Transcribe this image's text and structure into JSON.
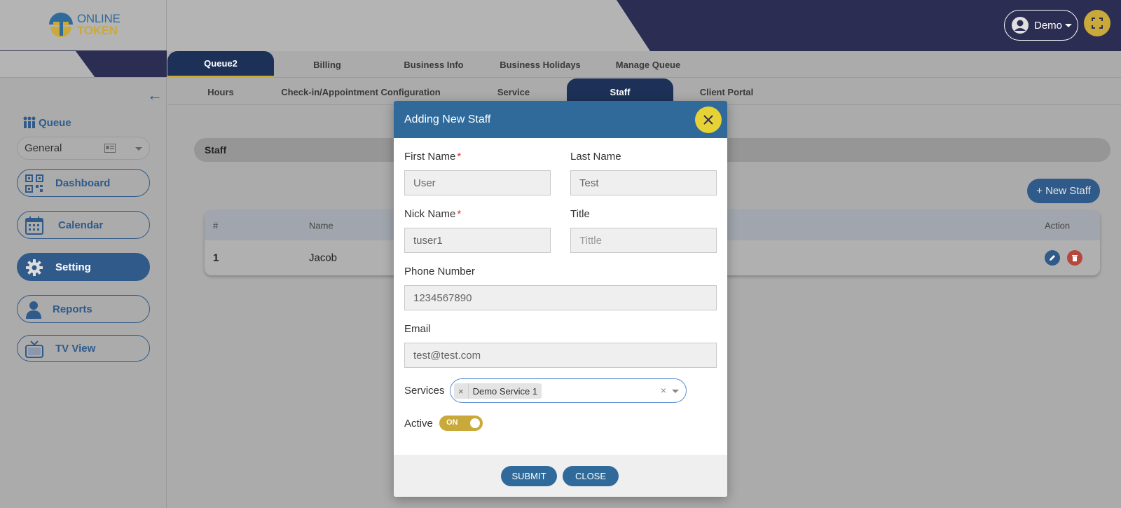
{
  "brand": {
    "line1": "ONLINE",
    "line2": "TOKEN"
  },
  "user_menu": {
    "label": "Demo"
  },
  "sidebar": {
    "queue_label": "Queue",
    "queue_select_value": "General",
    "items": [
      {
        "label": "Dashboard",
        "icon": "qr-code-icon",
        "active": false
      },
      {
        "label": "Calendar",
        "icon": "calendar-icon",
        "active": false
      },
      {
        "label": "Setting",
        "icon": "gear-icon",
        "active": true
      },
      {
        "label": "Reports",
        "icon": "person-icon",
        "active": false
      },
      {
        "label": "TV View",
        "icon": "tv-icon",
        "active": false
      }
    ]
  },
  "tabs_row1": [
    "Queue2",
    "Billing",
    "Business Info",
    "Business Holidays",
    "Manage Queue"
  ],
  "tabs_row2": [
    "Hours",
    "Check-in/Appointment Configuration",
    "Service",
    "Staff",
    "Client Portal"
  ],
  "active_tab_row1": "Queue2",
  "active_tab_row2": "Staff",
  "content": {
    "section_title": "Staff",
    "new_staff_button": "+ New Staff",
    "table": {
      "headers": [
        "#",
        "Name",
        "Action"
      ],
      "rows": [
        {
          "num": "1",
          "name": "Jacob"
        }
      ]
    }
  },
  "modal": {
    "title": "Adding New Staff",
    "first_name_label": "First Name",
    "first_name_value": "User",
    "last_name_label": "Last Name",
    "last_name_value": "Test",
    "nick_name_label": "Nick Name",
    "nick_name_value": "tuser1",
    "title_label": "Title",
    "title_placeholder": "Tittle",
    "phone_label": "Phone Number",
    "phone_value": "1234567890",
    "email_label": "Email",
    "email_value": "test@test.com",
    "services_label": "Services",
    "services_selected": "Demo Service 1",
    "chip_remove": "×",
    "clear_all": "×",
    "active_label": "Active",
    "toggle_text": "ON",
    "required_mark": "*",
    "submit_button": "SUBMIT",
    "close_button": "CLOSE"
  },
  "colors": {
    "navy": "#2b2d52",
    "primary_blue": "#2f6a9a",
    "gold": "#c9a93a",
    "delete_red": "#b5473d"
  }
}
